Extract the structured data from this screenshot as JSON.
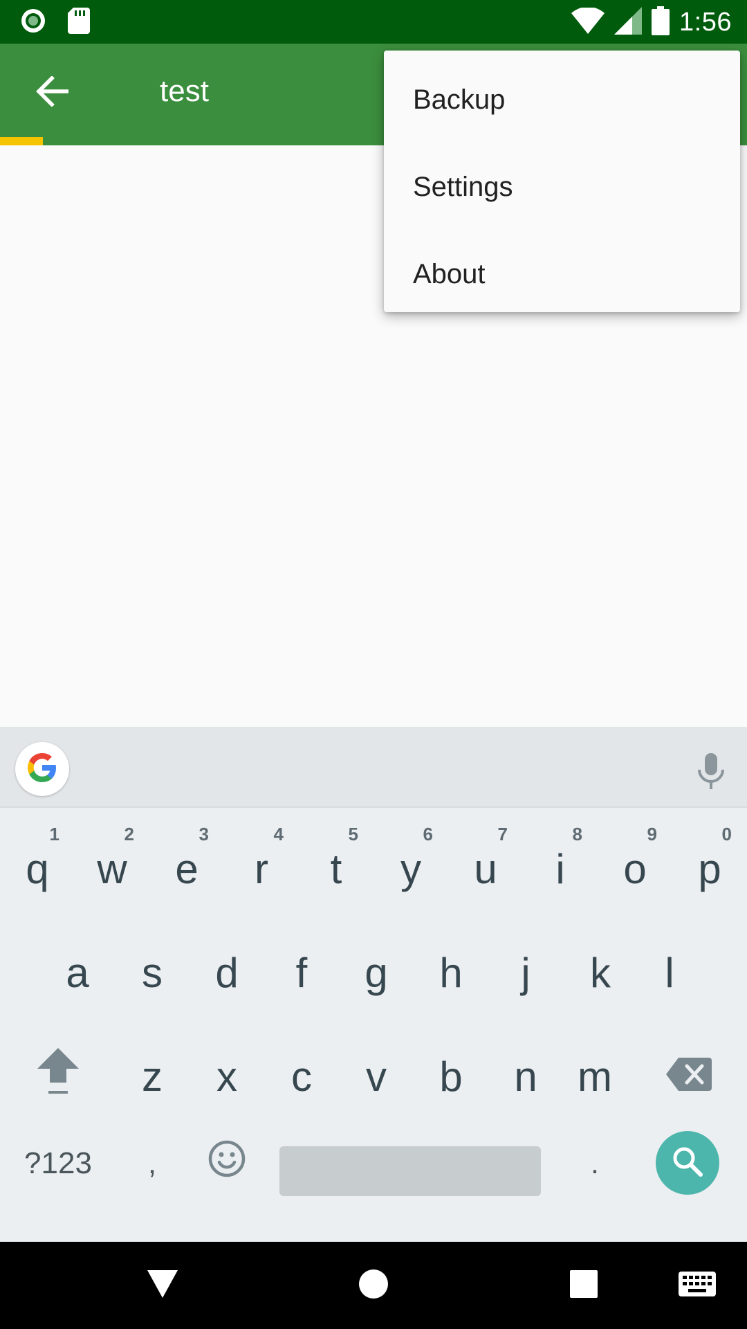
{
  "status_bar": {
    "time": "1:56",
    "icons": [
      "record-icon",
      "sd-card-icon",
      "wifi-icon",
      "signal-icon",
      "battery-icon"
    ]
  },
  "app_bar": {
    "title": "test",
    "back_icon": "arrow-back-icon",
    "colors": {
      "status": "#005C0C",
      "bar": "#3B8E3D",
      "indicator": "#F5C400"
    }
  },
  "overflow_menu": {
    "items": [
      {
        "label": "Backup"
      },
      {
        "label": "Settings"
      },
      {
        "label": "About"
      }
    ]
  },
  "keyboard": {
    "row1": [
      {
        "key": "q",
        "hint": "1"
      },
      {
        "key": "w",
        "hint": "2"
      },
      {
        "key": "e",
        "hint": "3"
      },
      {
        "key": "r",
        "hint": "4"
      },
      {
        "key": "t",
        "hint": "5"
      },
      {
        "key": "y",
        "hint": "6"
      },
      {
        "key": "u",
        "hint": "7"
      },
      {
        "key": "i",
        "hint": "8"
      },
      {
        "key": "o",
        "hint": "9"
      },
      {
        "key": "p",
        "hint": "0"
      }
    ],
    "row2": [
      "a",
      "s",
      "d",
      "f",
      "g",
      "h",
      "j",
      "k",
      "l"
    ],
    "row3": [
      "z",
      "x",
      "c",
      "v",
      "b",
      "n",
      "m"
    ],
    "symbols_label": "?123",
    "comma": ",",
    "period": ".",
    "accent_color": "#4DB6AC"
  },
  "nav_bar": {
    "icons": [
      "back-triangle-icon",
      "home-circle-icon",
      "recents-square-icon",
      "keyboard-switch-icon"
    ]
  }
}
